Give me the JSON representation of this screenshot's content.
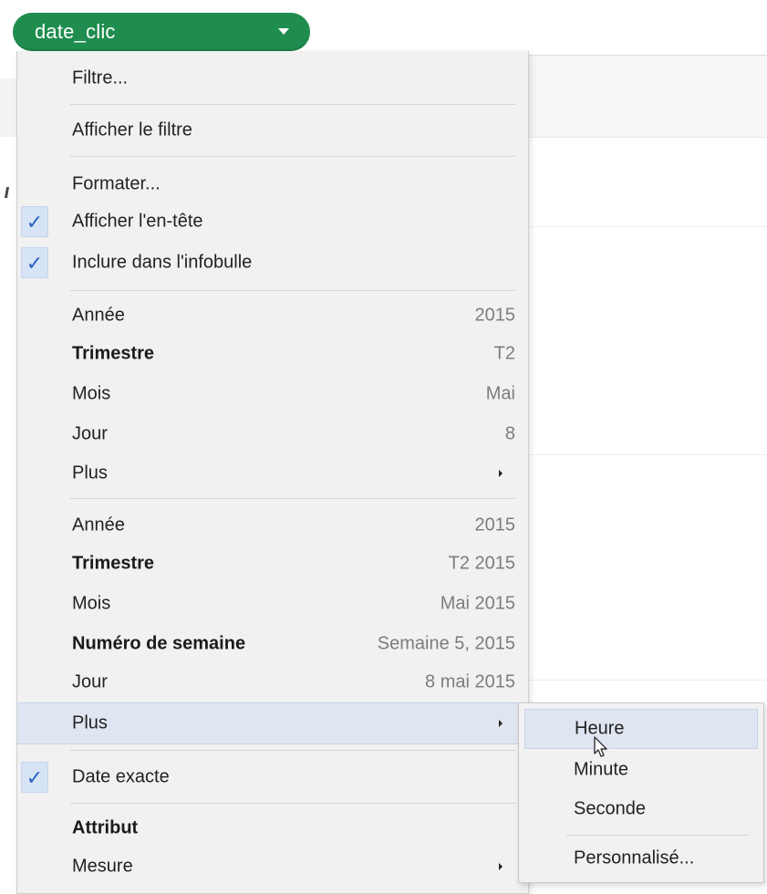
{
  "field_pill": {
    "label": "date_clic",
    "color": "#1e8d4e",
    "caret_icon": "caret-down-icon"
  },
  "menu": {
    "items": [
      {
        "label": "Filtre..."
      },
      {
        "label": "Afficher le filtre"
      },
      {
        "label": "Formater..."
      },
      {
        "label": "Afficher l'en-tête",
        "checked": true
      },
      {
        "label": "Inclure dans l'infobulle",
        "checked": true
      },
      {
        "label": "Année",
        "value": "2015"
      },
      {
        "label": "Trimestre",
        "value": "T2"
      },
      {
        "label": "Mois",
        "value": "Mai"
      },
      {
        "label": "Jour",
        "value": "8"
      },
      {
        "label": "Plus",
        "submenu": true
      },
      {
        "label": "Année",
        "value": "2015"
      },
      {
        "label": "Trimestre",
        "value": "T2 2015"
      },
      {
        "label": "Mois",
        "value": "Mai 2015"
      },
      {
        "label": "Numéro de semaine",
        "value": "Semaine 5, 2015"
      },
      {
        "label": "Jour",
        "value": "8 mai 2015"
      },
      {
        "label": "Plus",
        "submenu": true,
        "highlighted": true
      },
      {
        "label": "Date exacte",
        "checked": true
      },
      {
        "label": "Attribut"
      },
      {
        "label": "Mesure",
        "submenu": true
      }
    ]
  },
  "submenu": {
    "items": [
      {
        "label": "Heure",
        "highlighted": true
      },
      {
        "label": "Minute"
      },
      {
        "label": "Seconde"
      },
      {
        "label": "Personnalisé..."
      }
    ]
  },
  "colors": {
    "check": "#2b63c4",
    "highlight": "#dfe6f1",
    "menu_bg": "#f1f1f1"
  }
}
